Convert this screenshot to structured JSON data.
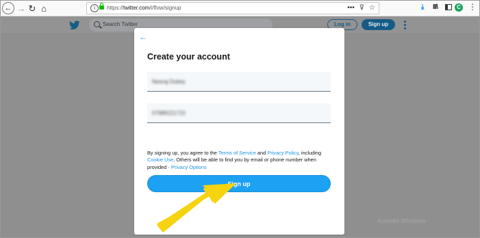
{
  "browser": {
    "url_prefix": "https://",
    "url_host": "twitter.com",
    "url_path": "/i/flow/signup",
    "url_more": "•••",
    "ext_letter": "C",
    "menu": "⋮"
  },
  "twitter_header": {
    "search_placeholder": "Search Twitter",
    "login_label": "Log in",
    "signup_label": "Sign up"
  },
  "modal": {
    "back": "←",
    "title": "Create your account",
    "name_value": "Neeraj Dubey",
    "phone_value": "07986221722",
    "terms": {
      "t1": "By signing up, you agree to the ",
      "terms_link": "Terms of Service",
      "t2": " and ",
      "privacy_link": "Privacy Policy",
      "t3": ", including ",
      "cookie_link": "Cookie Use",
      "t4": ". Others will be able to find you by email or phone number when provided · ",
      "options_link": "Privacy Options"
    },
    "signup_button": "Sign up"
  },
  "watermark": "Activate Windows",
  "colors": {
    "accent": "#1da1f2",
    "link": "#1b95e0",
    "overlay": "#8f8f8f",
    "arrow": "#f5d30f"
  },
  "icons": [
    "back-icon",
    "forward-icon",
    "reload-icon",
    "home-icon",
    "info-icon",
    "lock-icon",
    "pocket-icon",
    "bookmark-star-icon",
    "download-icon",
    "library-icon",
    "sidebar-icon",
    "extension-icon",
    "menu-icon",
    "twitter-bird-icon",
    "search-icon",
    "more-icon"
  ]
}
